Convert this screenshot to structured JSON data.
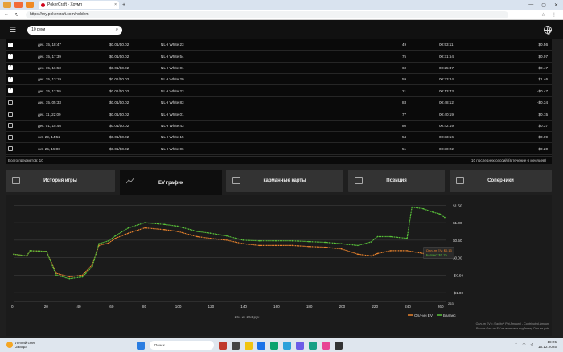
{
  "browser": {
    "tab_title": "PokerCraft - Хоумп",
    "url": "https://my.pokercraft.com/holdem",
    "colors": {
      "favicon": "#d0021b"
    }
  },
  "header": {
    "search_value": "10 руки"
  },
  "table": {
    "rows": [
      {
        "checked": true,
        "date": "дек. 15, 18:47",
        "stakes": "$0.01/$0.02",
        "table": "NLH White 23",
        "hands": "49",
        "time": "00:53:11",
        "result": "$0.56"
      },
      {
        "checked": true,
        "date": "дек. 15, 17:39",
        "stakes": "$0.01/$0.02",
        "table": "NLH White 54",
        "hands": "75",
        "time": "00:31:54",
        "result": "$0.07"
      },
      {
        "checked": true,
        "date": "дек. 15, 16:50",
        "stakes": "$0.01/$0.02",
        "table": "NLH White 01",
        "hands": "60",
        "time": "00:25:37",
        "result": "-$0.47"
      },
      {
        "checked": true,
        "date": "дек. 15, 13:19",
        "stakes": "$0.01/$0.02",
        "table": "NLH White 20",
        "hands": "59",
        "time": "00:33:24",
        "result": "$1.46"
      },
      {
        "checked": true,
        "date": "дек. 15, 12:55",
        "stakes": "$0.01/$0.02",
        "table": "NLH White 23",
        "hands": "21",
        "time": "00:13:43",
        "result": "-$0.47"
      },
      {
        "checked": false,
        "date": "дек. 15, 05:33",
        "stakes": "$0.01/$0.02",
        "table": "NLH White 83",
        "hands": "83",
        "time": "00:48:12",
        "result": "-$0.34"
      },
      {
        "checked": false,
        "date": "дек. 11, 22:09",
        "stakes": "$0.01/$0.02",
        "table": "NLH White 01",
        "hands": "77",
        "time": "00:40:19",
        "result": "$0.15"
      },
      {
        "checked": false,
        "date": "дек. 01, 15:46",
        "stakes": "$0.01/$0.02",
        "table": "NLH White 43",
        "hands": "80",
        "time": "00:42:19",
        "result": "$0.37"
      },
      {
        "checked": false,
        "date": "окт. 29, 14:52",
        "stakes": "$0.01/$0.02",
        "table": "NLH White 15",
        "hands": "54",
        "time": "00:33:16",
        "result": "$0.09"
      },
      {
        "checked": false,
        "date": "окт. 25, 15:08",
        "stakes": "$0.01/$0.02",
        "table": "NLH White 06",
        "hands": "51",
        "time": "00:30:22",
        "result": "$0.20"
      }
    ],
    "footer_left": "Всего предметов: 10",
    "footer_right": "10 последних сессий (в течение 6 месяцев)"
  },
  "tabs": [
    {
      "label": "История игры",
      "icon": "history-icon",
      "active": false
    },
    {
      "label": "EV график",
      "icon": "chart-icon",
      "active": true
    },
    {
      "label": "карманные карты",
      "icon": "cards-grid-icon",
      "active": false
    },
    {
      "label": "Позиция",
      "icon": "position-icon",
      "active": false
    },
    {
      "label": "Соперники",
      "icon": "opponents-icon",
      "active": false
    }
  ],
  "chart_data": {
    "type": "line",
    "x_ticks": [
      "0",
      "20",
      "40",
      "60",
      "80",
      "100",
      "120",
      "140",
      "160",
      "180",
      "200",
      "220",
      "240",
      "260"
    ],
    "x_end_label": "263",
    "y_ticks": [
      "$1.50",
      "$1.00",
      "$0.50",
      "$0.00",
      "-$0.50",
      "-$1.00"
    ],
    "xlim": [
      0,
      264
    ],
    "ylim": [
      -1.25,
      1.6
    ],
    "series": [
      {
        "name": "Олл-ин EV",
        "color": "#e8822c",
        "x": [
          0,
          8,
          10,
          20,
          26,
          34,
          42,
          44,
          48,
          52,
          58,
          62,
          70,
          80,
          92,
          100,
          112,
          120,
          130,
          140,
          150,
          160,
          170,
          180,
          190,
          200,
          210,
          218,
          222,
          230,
          240,
          250,
          256,
          260,
          263
        ],
        "y": [
          0.1,
          0.05,
          0.2,
          0.18,
          -0.45,
          -0.55,
          -0.5,
          -0.4,
          -0.2,
          0.35,
          0.42,
          0.55,
          0.7,
          0.85,
          0.8,
          0.75,
          0.6,
          0.55,
          0.5,
          0.4,
          0.35,
          0.35,
          0.35,
          0.32,
          0.3,
          0.25,
          0.1,
          0.05,
          0.12,
          0.2,
          0.2,
          0.12,
          0.1,
          0.12,
          0.13
        ]
      },
      {
        "name": "Баланс",
        "color": "#59c23a",
        "x": [
          0,
          8,
          10,
          20,
          26,
          34,
          42,
          44,
          48,
          52,
          58,
          62,
          70,
          80,
          92,
          100,
          112,
          120,
          130,
          140,
          150,
          160,
          170,
          180,
          190,
          200,
          210,
          218,
          222,
          230,
          240,
          243,
          250,
          256,
          260,
          263
        ],
        "y": [
          0.1,
          0.05,
          0.2,
          0.18,
          -0.5,
          -0.6,
          -0.55,
          -0.45,
          -0.25,
          0.4,
          0.48,
          0.62,
          0.85,
          1.0,
          0.95,
          0.9,
          0.75,
          0.7,
          0.62,
          0.5,
          0.48,
          0.48,
          0.48,
          0.46,
          0.44,
          0.4,
          0.35,
          0.45,
          0.6,
          0.6,
          0.55,
          1.45,
          1.4,
          1.3,
          1.25,
          1.15
        ]
      }
    ],
    "tooltip": {
      "line1": "Олл-ин EV: $0.13",
      "line2": "Баланс: $1.15"
    },
    "x_caption": "264 из 264 рук",
    "notes": [
      "Олл-ин EV = (Equity * Pot Amount) - Contributed Amount",
      "Расчет Олл-ин EV не включает подбегину Олл-ин pots"
    ],
    "legend_placement": "bottom-right"
  },
  "taskbar": {
    "weather_line1": "Легкий снег",
    "weather_line2": "Завтра",
    "search_placeholder": "Поиск",
    "time": "18:25",
    "date": "15.12.2025"
  }
}
